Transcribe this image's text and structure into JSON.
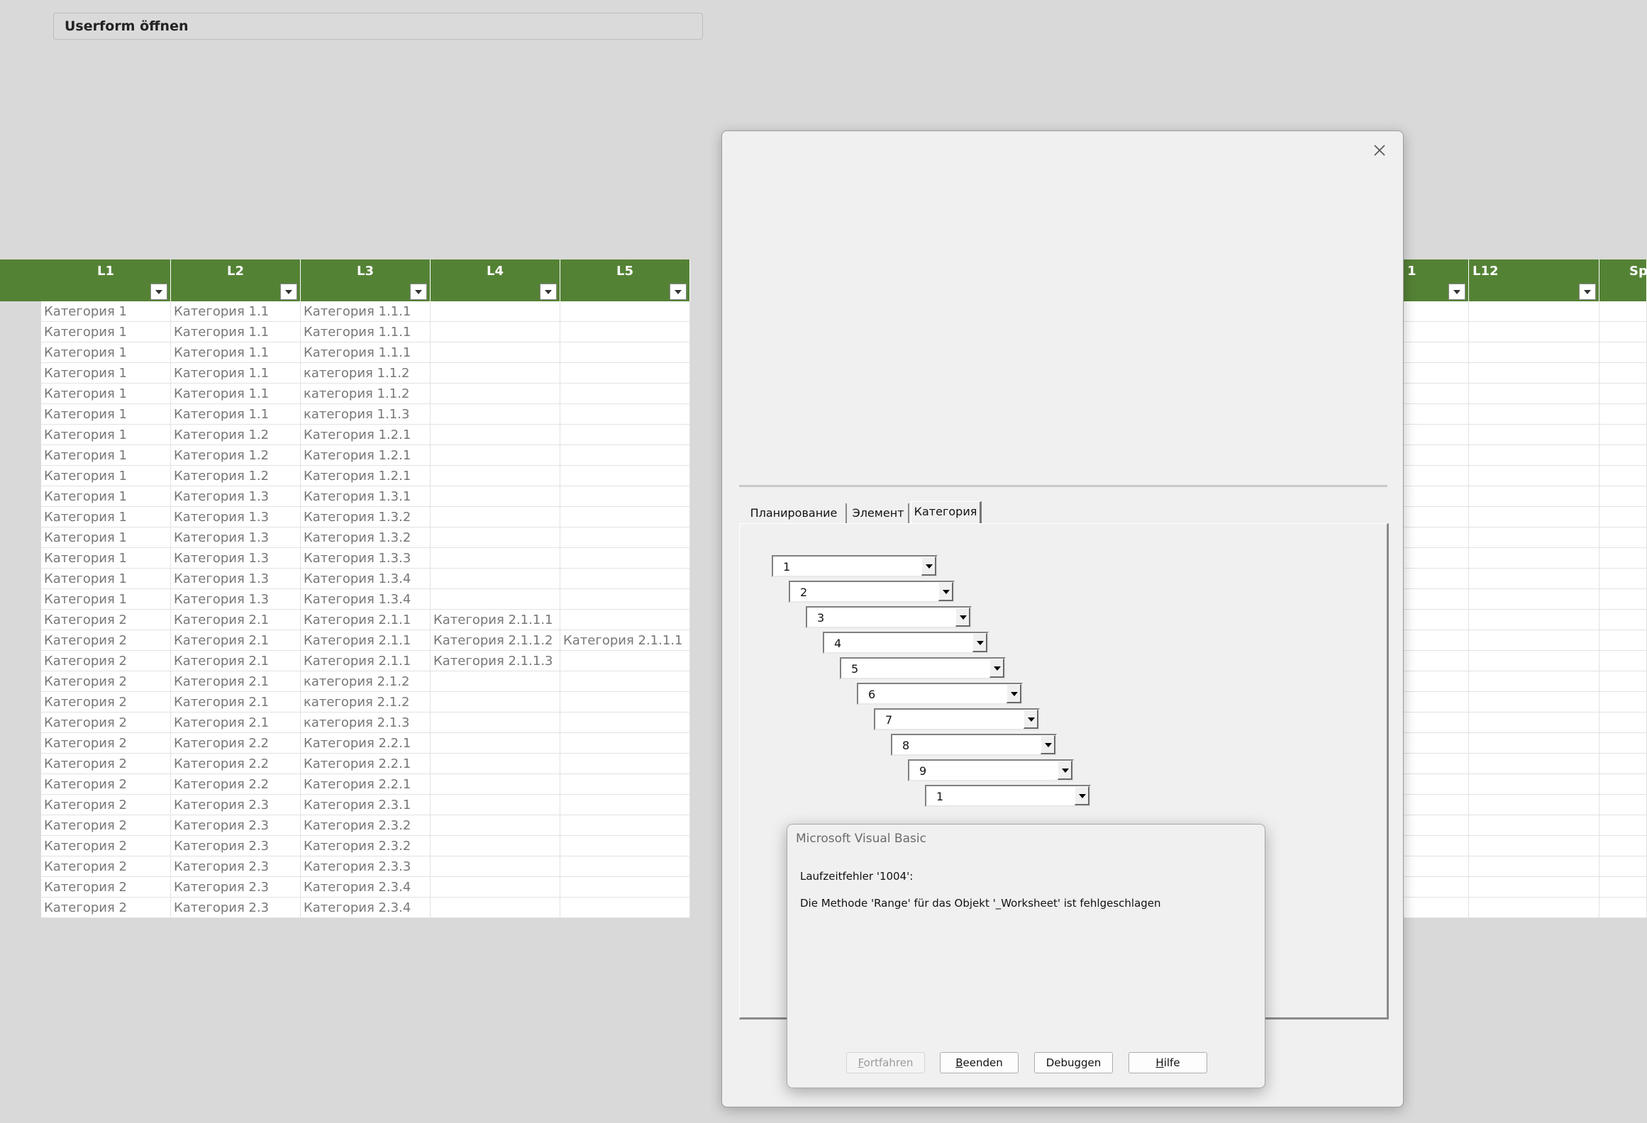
{
  "button_open_userform": "Userform öffnen",
  "table": {
    "headers": [
      "L1",
      "L2",
      "L3",
      "L4",
      "L5",
      "1",
      "L12",
      "Spa"
    ],
    "rows": [
      [
        "Категория 1",
        "Категория 1.1",
        "Категория 1.1.1",
        "",
        ""
      ],
      [
        "Категория 1",
        "Категория 1.1",
        "Категория 1.1.1",
        "",
        ""
      ],
      [
        "Категория 1",
        "Категория 1.1",
        "Категория 1.1.1",
        "",
        ""
      ],
      [
        "Категория 1",
        "Категория 1.1",
        "категория 1.1.2",
        "",
        ""
      ],
      [
        "Категория 1",
        "Категория 1.1",
        "категория 1.1.2",
        "",
        ""
      ],
      [
        "Категория 1",
        "Категория 1.1",
        "категория 1.1.3",
        "",
        ""
      ],
      [
        "Категория 1",
        "Категория 1.2",
        "Категория 1.2.1",
        "",
        ""
      ],
      [
        "Категория 1",
        "Категория 1.2",
        "Категория 1.2.1",
        "",
        ""
      ],
      [
        "Категория 1",
        "Категория 1.2",
        "Категория 1.2.1",
        "",
        ""
      ],
      [
        "Категория 1",
        "Категория 1.3",
        "Категория 1.3.1",
        "",
        ""
      ],
      [
        "Категория 1",
        "Категория 1.3",
        "Категория 1.3.2",
        "",
        ""
      ],
      [
        "Категория 1",
        "Категория 1.3",
        "Категория 1.3.2",
        "",
        ""
      ],
      [
        "Категория 1",
        "Категория 1.3",
        "Категория 1.3.3",
        "",
        ""
      ],
      [
        "Категория 1",
        "Категория 1.3",
        "Категория 1.3.4",
        "",
        ""
      ],
      [
        "Категория 1",
        "Категория 1.3",
        "Категория 1.3.4",
        "",
        ""
      ],
      [
        "Категория 2",
        "Категория 2.1",
        "Категория 2.1.1",
        "Категория 2.1.1.1",
        ""
      ],
      [
        "Категория 2",
        "Категория 2.1",
        "Категория 2.1.1",
        "Категория 2.1.1.2",
        "Категория 2.1.1.1"
      ],
      [
        "Категория 2",
        "Категория 2.1",
        "Категория 2.1.1",
        "Категория 2.1.1.3",
        ""
      ],
      [
        "Категория 2",
        "Категория 2.1",
        "категория 2.1.2",
        "",
        ""
      ],
      [
        "Категория 2",
        "Категория 2.1",
        "категория 2.1.2",
        "",
        ""
      ],
      [
        "Категория 2",
        "Категория 2.1",
        "категория 2.1.3",
        "",
        ""
      ],
      [
        "Категория 2",
        "Категория 2.2",
        "Категория 2.2.1",
        "",
        ""
      ],
      [
        "Категория 2",
        "Категория 2.2",
        "Категория 2.2.1",
        "",
        ""
      ],
      [
        "Категория 2",
        "Категория 2.2",
        "Категория 2.2.1",
        "",
        ""
      ],
      [
        "Категория 2",
        "Категория 2.3",
        "Категория 2.3.1",
        "",
        ""
      ],
      [
        "Категория 2",
        "Категория 2.3",
        "Категория 2.3.2",
        "",
        ""
      ],
      [
        "Категория 2",
        "Категория 2.3",
        "Категория 2.3.2",
        "",
        ""
      ],
      [
        "Категория 2",
        "Категория 2.3",
        "Категория 2.3.3",
        "",
        ""
      ],
      [
        "Категория 2",
        "Категория 2.3",
        "Категория 2.3.4",
        "",
        ""
      ],
      [
        "Категория 2",
        "Категория 2.3",
        "Категория 2.3.4",
        "",
        ""
      ]
    ]
  },
  "userform": {
    "tabs": [
      {
        "label": "Планирование",
        "active": false
      },
      {
        "label": "Элемент",
        "active": false
      },
      {
        "label": "Категория",
        "active": true
      }
    ],
    "combos": [
      "1",
      "2",
      "3",
      "4",
      "5",
      "6",
      "7",
      "8",
      "9",
      "1"
    ]
  },
  "msgbox": {
    "title": "Microsoft Visual Basic",
    "line1": "Laufzeitfehler '1004':",
    "line2": "Die Methode 'Range' für das Objekt '_Worksheet' ist fehlgeschlagen",
    "buttons": [
      {
        "label": "Fortfahren",
        "accel": "F",
        "rest": "ortfahren",
        "enabled": false
      },
      {
        "label": "Beenden",
        "accel": "B",
        "rest": "eenden",
        "enabled": true
      },
      {
        "label": "Debuggen",
        "accel": "",
        "rest": "Debuggen",
        "enabled": true
      },
      {
        "label": "Hilfe",
        "accel": "H",
        "rest": "ilfe",
        "enabled": true
      }
    ]
  },
  "colors": {
    "header_green": "#548235",
    "form_bg": "#f0f0f0",
    "sheet_bg": "#d9d9d9"
  }
}
